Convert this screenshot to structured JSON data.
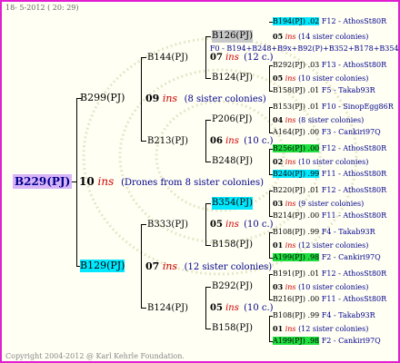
{
  "header": {
    "date": "18- 5-2012 ( 20: 29)"
  },
  "footer": {
    "copyright": "Copyright 2004-2012 @ Karl Kehrle Foundation."
  },
  "colors": {
    "frame": "#e020d0",
    "root_bg": "#d8b4f8",
    "cyan": "#00e8ff",
    "green": "#20e040",
    "gray": "#c8c8c8",
    "ins": "#d00000",
    "blue": "#00008b"
  },
  "root": {
    "label": "B229(PJ)",
    "year": "10",
    "ins": "ins",
    "note": "(Drones from 8 sister colonies)"
  },
  "gen1": [
    {
      "label": "B299(PJ)",
      "year": "09",
      "ins": "ins",
      "note": "(8 sister colonies)"
    },
    {
      "label": "B129(PJ)",
      "year": "07",
      "ins": "ins",
      "note": "(12 sister colonies)"
    }
  ],
  "gen2": [
    {
      "label": "B144(PJ)",
      "year": "07",
      "ins": "ins",
      "note": "(12 c.)"
    },
    {
      "label": "B213(PJ)",
      "year": "06",
      "ins": "ins",
      "note": "(10 c.)"
    },
    {
      "label": "B333(PJ)",
      "year": "05",
      "ins": "ins",
      "note": "(10 c.)"
    },
    {
      "label": "B124(PJ)",
      "year": "05",
      "ins": "ins",
      "note": "(10 c.)"
    }
  ],
  "gen3": [
    "B126(PJ)",
    "B124(PJ)",
    "P206(PJ)",
    "B248(PJ)",
    "B354(PJ)",
    "B158(PJ)",
    "B292(PJ)",
    "B158(PJ)"
  ],
  "overlay": "F0 - B194+B248+B9x+B92(P)+B352+B178+B354",
  "gen4": [
    {
      "top": "B194(PJ) .02",
      "top_dest": "F12 - AthosSt80R",
      "year": "05",
      "ins": "ins",
      "note": "(14 sister colonies)"
    },
    {
      "top": "B292(PJ) .03",
      "top_dest": "F13 - AthosSt80R",
      "year": "05",
      "ins": "ins",
      "note": "(10 sister colonies)",
      "bottom": "B158(PJ) .01",
      "bottom_dest": "F5 - Takab93R"
    },
    {
      "top": "B153(PJ) .01",
      "top_dest": "F10 - SinopEgg86R",
      "year": "04",
      "ins": "ins",
      "note": "(8 sister colonies)",
      "bottom": "A164(PJ) .00",
      "bottom_dest": "F3 - Cankiri97Q"
    },
    {
      "top": "B256(PJ) .00",
      "top_dest": "F12 - AthosSt80R",
      "year": "02",
      "ins": "ins",
      "note": "(10 sister colonies)",
      "bottom": "B240(PJ) .99",
      "bottom_dest": "F11 - AthosSt80R"
    },
    {
      "top": "B220(PJ) .01",
      "top_dest": "F12 - AthosSt80R",
      "year": "03",
      "ins": "ins",
      "note": "(9 sister colonies)",
      "bottom": "B214(PJ) .00",
      "bottom_dest": "F11 - AthosSt80R"
    },
    {
      "top": "B108(PJ) .99",
      "top_dest": "F4 - Takab93R",
      "year": "01",
      "ins": "ins",
      "note": "(12 sister colonies)",
      "bottom": "A199(PJ) .98",
      "bottom_dest": "F2 - Cankiri97Q"
    },
    {
      "top": "B191(PJ) .01",
      "top_dest": "F12 - AthosSt80R",
      "year": "03",
      "ins": "ins",
      "note": "(10 sister colonies)",
      "bottom": "B216(PJ) .00",
      "bottom_dest": "F11 - AthosSt80R"
    },
    {
      "top": "B108(PJ) .99",
      "top_dest": "F4 - Takab93R",
      "year": "01",
      "ins": "ins",
      "note": "(12 sister colonies)",
      "bottom": "A199(PJ) .98",
      "bottom_dest": "F2 - Cankiri97Q"
    }
  ]
}
